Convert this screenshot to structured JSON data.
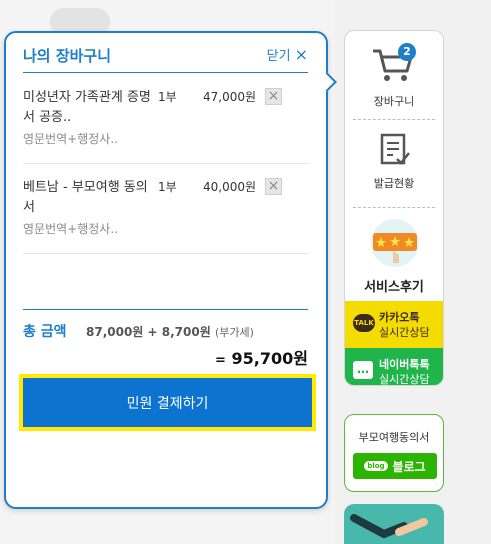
{
  "cart": {
    "title": "나의 장바구니",
    "close_label": "닫기",
    "items": [
      {
        "name": "미성년자 가족관계 증명서 공증..",
        "sub": "영문번역+행정사..",
        "qty": "1부",
        "price": "47,000원"
      },
      {
        "name": "베트남 - 부모여행 동의서",
        "sub": "영문번역+행정사..",
        "qty": "1부",
        "price": "40,000원"
      }
    ],
    "total_label": "총 금액",
    "total_formula": "87,000원 + 8,700원",
    "vat_label": "(부가세)",
    "total_eq": "=",
    "total_final": "95,700원",
    "pay_label": "민원 결제하기"
  },
  "sidebar": {
    "cart_count": "2",
    "cart_label": "장바구니",
    "status_label": "발급현황",
    "review_label": "서비스후기",
    "kakao_title": "카카오톡",
    "kakao_sub": "실시간상담",
    "kakao_icon": "TALK",
    "naver_title": "네이버톡톡",
    "naver_sub": "실시간상담",
    "blog_title": "부모여행동의서",
    "blog_tag": "blog",
    "blog_label": "블로그"
  },
  "colors": {
    "accent": "#1e7fc8",
    "pay_button": "#0d73d0",
    "highlight": "#ffea00",
    "kakao": "#f5dc00",
    "naver": "#20b54b"
  }
}
